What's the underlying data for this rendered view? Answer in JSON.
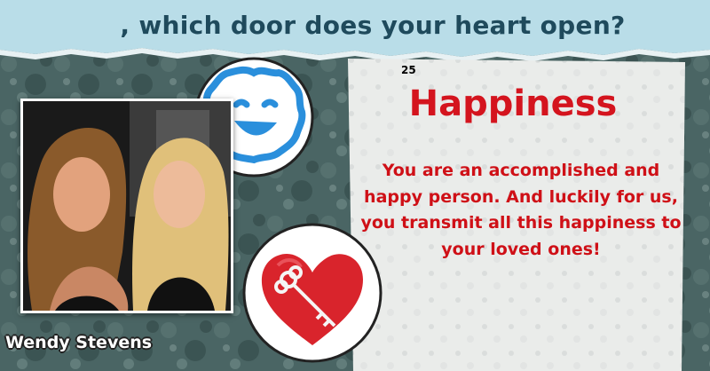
{
  "header": {
    "question": ", which door does your heart open?"
  },
  "result": {
    "number": "25",
    "title": "Happiness",
    "description": "You are an accomplished and happy person. And luckily for us, you transmit all this happiness to your loved ones!"
  },
  "photo": {
    "caption": "Wendy Stevens"
  },
  "icons": {
    "face": "smiley-cloud-icon",
    "heart": "heart-key-icon"
  },
  "colors": {
    "accent": "#d4141e",
    "title": "#1f4a5c",
    "banner": "#b9dde8",
    "background": "#3d5a5a"
  }
}
